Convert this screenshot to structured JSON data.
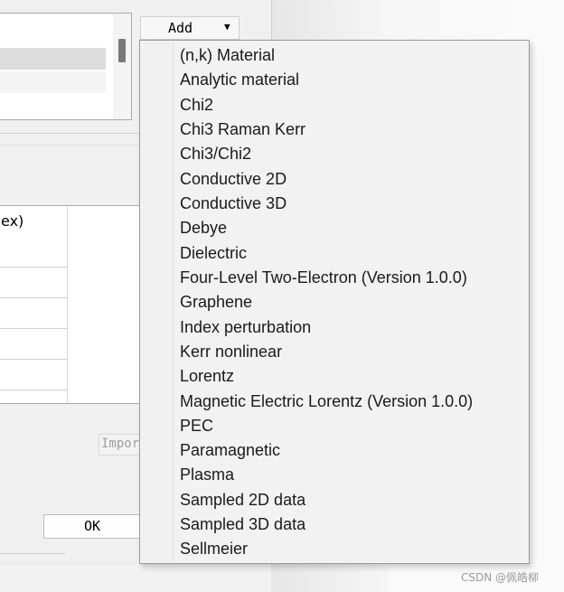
{
  "add_button": {
    "label": "Add",
    "caret": "▼"
  },
  "properties": {
    "header_fragment": "ex)"
  },
  "import_button": {
    "label": "Impor"
  },
  "ok_button": {
    "label": "OK"
  },
  "menu": {
    "items": [
      "(n,k) Material",
      "Analytic material",
      "Chi2",
      "Chi3 Raman Kerr",
      "Chi3/Chi2",
      "Conductive 2D",
      "Conductive 3D",
      "Debye",
      "Dielectric",
      "Four-Level Two-Electron (Version 1.0.0)",
      "Graphene",
      "Index perturbation",
      "Kerr nonlinear",
      "Lorentz",
      "Magnetic Electric Lorentz (Version 1.0.0)",
      "PEC",
      "Paramagnetic",
      "Plasma",
      "Sampled 2D data",
      "Sampled 3D data",
      "Sellmeier"
    ]
  },
  "watermark": "CSDN @佩皓柳",
  "colors": {
    "menu_bg": "#f2f2f2",
    "menu_border": "#9a9a9a",
    "selected_row": "#dcdcdc"
  }
}
